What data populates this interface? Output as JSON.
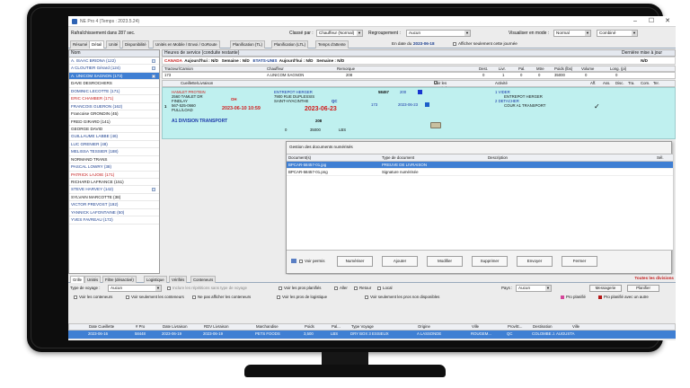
{
  "window": {
    "title": "NE Pro 4 (Temps : 2023.5.24)",
    "buttons": [
      "–",
      "☐",
      "✕"
    ]
  },
  "toolbar": {
    "count_text": "Rafraîchissement dans 287 sec.",
    "classe_label": "Classé par :",
    "classe_value": "Chauffeur (Normal)",
    "regroupement_label": "Regroupement :",
    "regroupement_value": "Aucun",
    "mode_label": "Visualiser en mode :",
    "mode_value": "Normal",
    "combine_value": "Combiné"
  },
  "tabs": [
    "Résumé",
    "Détail",
    "Unité",
    "Disponibilité",
    "Unités en Mobile / Envoi / GoRoute",
    "Planification (TL)",
    "Planification (LTL)",
    "Temps d'attente"
  ],
  "tabs_active": 1,
  "date_label": "En date du :",
  "date_value": "2023-06-18",
  "only_today": "Afficher seulement cette journée",
  "left_list": {
    "header": "Nom",
    "items": [
      {
        "label": "A. ISAAC BRIDNA (122)",
        "style": "blue"
      },
      {
        "label": "A CLOUTIER Gérard (124)",
        "style": "blue"
      },
      {
        "label": "A. UNICOM SAGNON (173)",
        "style": "selected"
      },
      {
        "label": "DAVE DESROCHERS",
        "style": "normal"
      },
      {
        "label": "DOMINIC LECOTTE (171)",
        "style": "blue"
      },
      {
        "label": "ERIC CHAMBER (171)",
        "style": "red"
      },
      {
        "label": "FRANCOIS GUERON (162)",
        "style": "blue"
      },
      {
        "label": "Francoise GRONDIN (45)",
        "style": "normal"
      },
      {
        "label": "FRED GIRARD (141)",
        "style": "normal"
      },
      {
        "label": "GEORGE DAVID",
        "style": "normal"
      },
      {
        "label": "GUILLAUME LABBE (46)",
        "style": "blue"
      },
      {
        "label": "LUC GRENIER (48)",
        "style": "blue"
      },
      {
        "label": "MELISSA TESSIER (188)",
        "style": "blue"
      },
      {
        "label": "NORMAND TRANS",
        "style": "normal"
      },
      {
        "label": "PASCAL LOWRY (38)",
        "style": "blue"
      },
      {
        "label": "PATRICK LAJOIE (171)",
        "style": "red"
      },
      {
        "label": "RICHARD LAFRANCE (151)",
        "style": "normal"
      },
      {
        "label": "STEVE HARVEY (142)",
        "style": "blue"
      },
      {
        "label": "SYLVAIN MARCOTTE (38)",
        "style": "normal"
      },
      {
        "label": "VICTOR PREVOST (192)",
        "style": "blue"
      },
      {
        "label": "YANNICK LAFONTAINE (50)",
        "style": "blue"
      },
      {
        "label": "YVES FAVREAU (172)",
        "style": "blue"
      }
    ]
  },
  "detail_header": {
    "left": "Heures de service (conduite restante)",
    "right": "Dernière mise à jour"
  },
  "info_bar": {
    "canada": "CANADA",
    "today": "Aujourd'hui :",
    "today_val": "N/D",
    "week": "Semaine :",
    "week_val": "N/D",
    "usa": "ETATS-UNIS",
    "today2": "Aujourd'hui :",
    "today2_val": "N/D",
    "week2": "Semaine :",
    "week2_val": "N/D",
    "right_val": "N/D"
  },
  "grid": {
    "headers": [
      "Tracteur/Camion",
      "Chauffeur",
      "Remorque",
      "Dest.",
      "Livr.",
      "Pal.",
      "Mtre",
      "Poids (lbs)",
      "Volume",
      "Long. (pi)"
    ],
    "row": [
      "173",
      "A.UNICOM SAGNON",
      "208",
      "0",
      "1",
      "0",
      "0",
      "35000",
      "0",
      "0"
    ]
  },
  "subheader": {
    "left": "Cueillette/Livraison",
    "done": "Voir les terminées",
    "activity": "Activité",
    "cols": [
      "Aff.",
      "Ass.",
      "Disc.",
      "Tra.",
      "Com.",
      "Ter."
    ]
  },
  "detail": {
    "shipper_name": "HAMLET PROTEIN",
    "shipper_addr1": "2560 TAMLET DR",
    "shipper_addr2": "FINDLAY",
    "shipper_phone": "567-525-0660",
    "shipper_ship": "PULL/LOAD",
    "state": "OH",
    "pick_date": "2023-06-10 10:59",
    "consignee_name": "ENTREPOT HERGER",
    "consignee_addr": "7900 RUE DUPLESSIS",
    "consignee_city": "SAINT-HYACINTHE",
    "prov": "QC",
    "deliv_date": "2023-06-23",
    "order_no": "58457",
    "pro": "200",
    "pro2": "173",
    "date_small": "2023-06-23",
    "num_208": "208",
    "weight": "35000",
    "unit": "LBS",
    "zero": "0",
    "division": "A1 DIVISION TRANSPORT",
    "activities": [
      "1  VIDER",
      "ENTREPOT HERGER",
      "2  DETACHER",
      "COUR A1 TRANSPORT"
    ],
    "check": "✓"
  },
  "dialog": {
    "title": "Gestion des documents numérisés",
    "columns": [
      "Document(s)",
      "Type de document",
      "Description",
      "Sél."
    ],
    "rows": [
      {
        "doc": "BPCAR-58457-01.jpg",
        "type": "PREUVE DE LIVRAISON",
        "desc": "",
        "highlight": true
      },
      {
        "doc": "BPCAR-58457-01.png",
        "type": "Signature numérisée",
        "desc": "",
        "highlight": false
      }
    ],
    "view_label": "Voir permis",
    "buttons": [
      "Numériser",
      "Ajouter",
      "Modifier",
      "Supprimer",
      "Envoyer",
      "Fermer"
    ]
  },
  "bottom": {
    "tabs": [
      "Grille",
      "Unités",
      "Filtre (désactivé)",
      "Logistique",
      "Vérifiés",
      "Conteneurs"
    ],
    "tabs_active": 0,
    "all_divisions": "Toutes les divisions",
    "type_label": "Type de voyage :",
    "type_value": "Aucun",
    "include_repetitions": "Inclure les répétitions sans type de voyage",
    "pro_planifies": "Voir les pros planifiés",
    "aller": "Aller",
    "retour": "Retour",
    "local": "Local",
    "pays_label": "Pays :",
    "pays_value": "Aucun",
    "messagerie_btn": "Messagerie",
    "planifier_btn": "Planifier",
    "voir_conteneurs": "Voir les conteneurs",
    "seulement_conteneurs": "Voir seulement les conteneurs",
    "ne_pas_afficher": "Ne pas afficher les conteneurs",
    "logistique": "Voir les pros de logistique",
    "seulement_disponibles": "Voir seulement les pros non disponibles",
    "pro_planifie": "Pro planifié",
    "pro_planifie_autre": "Pro planifié avec un autre",
    "pro_planifie_color": "#d4479a",
    "pro_planifie_autre_color": "#b51717",
    "table_headers": [
      "Date Cueillette",
      "# Pro",
      "Date Livraison",
      "RDV Livraison",
      "Marchandise",
      "Poids",
      "Pal...",
      "Type Voyage",
      "Origine",
      "Ville",
      "Prov/E...",
      "Destination",
      "Ville"
    ],
    "table_row": [
      "2023-06-16",
      "58448",
      "2023-06-19",
      "2023-06-19",
      "PETS FOODS",
      "3,500",
      "LBS",
      "DRY BOX 3 ESSIEUX",
      "A LASSONDE",
      "ROUGEM...",
      "QC",
      "COLOMBE J. AUGUSTA",
      ""
    ]
  }
}
